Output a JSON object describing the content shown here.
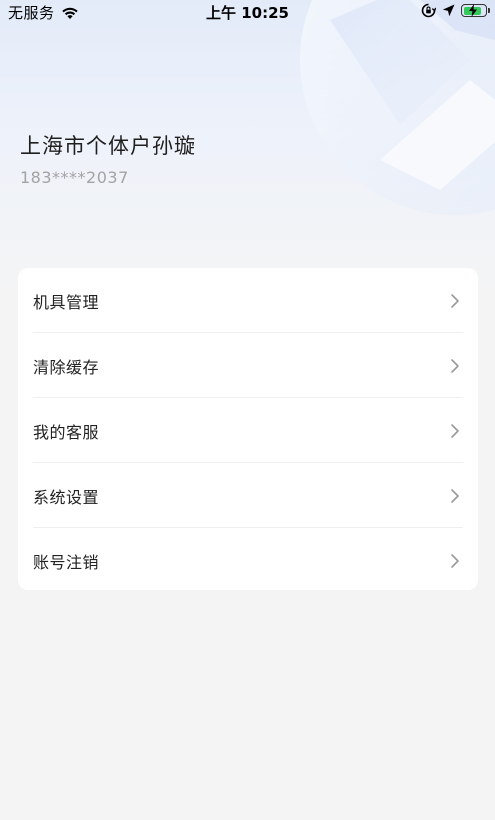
{
  "status_bar": {
    "carrier": "无服务",
    "time": "上午 10:25",
    "wifi_icon": "wifi-icon",
    "lock_rotation_icon": "orientation-lock-icon",
    "location_icon": "location-arrow-icon",
    "battery_icon": "battery-charging-icon",
    "battery_level": 0.85,
    "battery_color": "#34c759"
  },
  "profile": {
    "name": "上海市个体户孙璇",
    "phone": "183****2037"
  },
  "menu": {
    "items": [
      {
        "label": "机具管理",
        "icon": "chevron-right-icon"
      },
      {
        "label": "清除缓存",
        "icon": "chevron-right-icon"
      },
      {
        "label": "我的客服",
        "icon": "chevron-right-icon"
      },
      {
        "label": "系统设置",
        "icon": "chevron-right-icon"
      },
      {
        "label": "账号注销",
        "icon": "chevron-right-icon"
      }
    ]
  },
  "colors": {
    "background": "#f4f4f5",
    "header_gradient_top": "#e3ebf9",
    "card": "#ffffff",
    "secondary_text": "#a3a3a3"
  }
}
